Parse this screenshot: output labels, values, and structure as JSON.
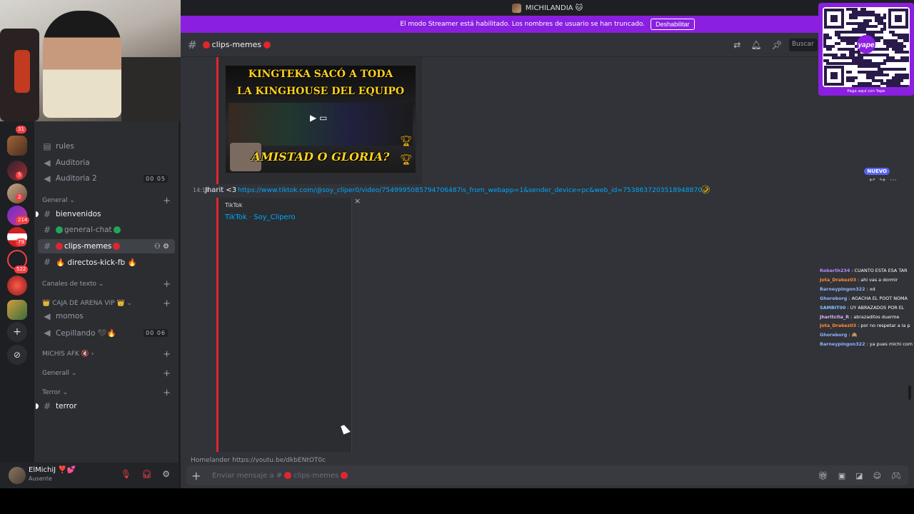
{
  "topbar": {
    "server_title": "MICHILANDIA 🐱"
  },
  "streamer": {
    "notice": "El modo Streamer está habilitado. Los nombres de usuario se han truncado.",
    "disable_label": "Deshabilitar"
  },
  "header": {
    "channel_name": "clips-memes",
    "search_placeholder": "Buscar"
  },
  "guilds": [
    {
      "badge": "31"
    },
    {
      "badge": "5"
    },
    {
      "badge": "2"
    },
    {
      "badge": "214"
    },
    {
      "badge": "79"
    },
    {
      "badge": "522"
    }
  ],
  "channels": {
    "rules": "rules",
    "auditoria": "Auditoria",
    "auditoria2": "Auditoria 2",
    "auditoria2_count": "00 05",
    "cat_general": "General",
    "bienvenidos": "bienvenidos",
    "general_chat": "general-chat",
    "clips_memes": "clips-memes",
    "directos": "🔥 directos-kick-fb 🔥",
    "cat_texto": "Canales de texto",
    "cat_caja": "👑 CAJA DE ARENA VIP 👑",
    "momos": "momos",
    "cepillando": "Cepillando 🖤🔥",
    "cepillando_count": "00 06",
    "cat_afk": "MICHIS AFK 🔇",
    "cat_generall": "Generall",
    "cat_terror": "Terror",
    "terror": "terror"
  },
  "user": {
    "name": "ElMichiJ ❣️💕",
    "status": "Ausente"
  },
  "video": {
    "line1": "KINGTEKA SACÓ A TODA",
    "line2": "LA KINGHOUSE DEL EQUIPO",
    "line3": "AMISTAD O GLORIA?"
  },
  "message": {
    "time": "14:18",
    "author": "Jharit <3",
    "link": "https://www.tiktok.com/@soy_cliper0/video/7549995085794706487is_from_webapp=1&sender_device=pc&web_id=7538637203518948870",
    "new_label": "NUEVO"
  },
  "embed": {
    "provider": "TikTok",
    "title": "TikTok · Soy_Clipero"
  },
  "next_message": "Homelander  https://youtu.be/dkbENtOT0c",
  "overlay_chat": [
    {
      "user": "Roberth234",
      "text": "CUANTO ESTA ESA TAR",
      "color": "#b28cff"
    },
    {
      "user": "Jota_Drakez03",
      "text": "ahi vas a dormir",
      "color": "#ff8a3d"
    },
    {
      "user": "Barneypingon322",
      "text": "xd",
      "color": "#8fb4ff"
    },
    {
      "user": "Ghoreborg",
      "text": "AGACHA EL POOT NOMA",
      "color": "#8fb4ff"
    },
    {
      "user": "SAMBIT00",
      "text": "UY ABRAZADOS POR EL",
      "color": "#7ec3ff"
    },
    {
      "user": "Jharitcita_R",
      "text": "abrazaditos duerme",
      "color": "#d8b4ff"
    },
    {
      "user": "Jota_Drakez03",
      "text": "por no respetar a la p",
      "color": "#ff8a3d"
    },
    {
      "user": "Ghoreborg",
      "text": "🙈",
      "color": "#8fb4ff"
    },
    {
      "user": "Barneypingon322",
      "text": "ya pues michi com",
      "color": "#8fb4ff"
    }
  ],
  "qr": {
    "caption": "Paga aquí con Yape",
    "brand": "yape"
  },
  "composer": {
    "placeholder": "Enviar mensaje a #",
    "channel": "clips-memes"
  }
}
